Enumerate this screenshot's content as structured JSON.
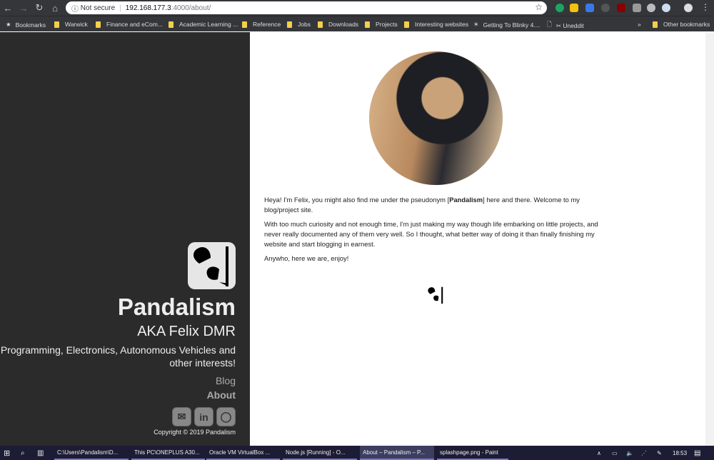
{
  "browser": {
    "security_label": "Not secure",
    "url_host": "192.168.177.3",
    "url_path": ":4000/about/",
    "bookmarks": [
      {
        "label": "Bookmarks",
        "icon": "star-icon"
      },
      {
        "label": "Warwick",
        "icon": "folder-icon"
      },
      {
        "label": "Finance and eCom...",
        "icon": "folder-icon"
      },
      {
        "label": "Academic Learning ...",
        "icon": "folder-icon"
      },
      {
        "label": "Reference",
        "icon": "folder-icon"
      },
      {
        "label": "Jobs",
        "icon": "folder-icon"
      },
      {
        "label": "Downloads",
        "icon": "folder-icon"
      },
      {
        "label": "Projects",
        "icon": "folder-icon"
      },
      {
        "label": "Interesting websites",
        "icon": "folder-icon"
      },
      {
        "label": "Getting To Blinky 4....",
        "icon": "page-icon"
      },
      {
        "label": "✂ Uneddit",
        "icon": "document-icon"
      }
    ],
    "overflow": "»",
    "other_bookmarks": "Other bookmarks"
  },
  "sidebar": {
    "title": "Pandalism",
    "aka": "AKA Felix DMR",
    "tagline": "Programming, Electronics, Autonomous Vehicles and other interests!",
    "nav": [
      {
        "label": "Blog",
        "active": false
      },
      {
        "label": "About",
        "active": true
      }
    ],
    "social": [
      "email-icon",
      "linkedin-icon",
      "github-icon"
    ],
    "copyright": "Copyright © 2019 Pandalism"
  },
  "main": {
    "p1_before": "Heya! I'm Felix, you might also find me under the pseudonym [",
    "p1_bold": "Pandalism",
    "p1_after": "] here and there. Welcome to my blog/project site.",
    "p2": "With too much curiosity and not enough time, I'm just making my way though life embarking on little projects, and never really documented any of them very well. So I thought, what better way of doing it than finally finishing my website and start blogging in earnest.",
    "p3": "Anywho, here we are, enjoy!"
  },
  "taskbar": {
    "items": [
      "C:\\Users\\Pandalism\\D...",
      "This PC\\ONEPLUS A30...",
      "Oracle VM VirtualBox ...",
      "Node.js [Running] - O...",
      "About – Pandalism – P...",
      "splashpage.png - Paint"
    ],
    "active_index": 4,
    "clock": "18:53"
  },
  "colors": {
    "sidebar_bg": "#2b2b2b",
    "accent_folder": "#f3d04a",
    "taskbar": "#1c1c34"
  }
}
